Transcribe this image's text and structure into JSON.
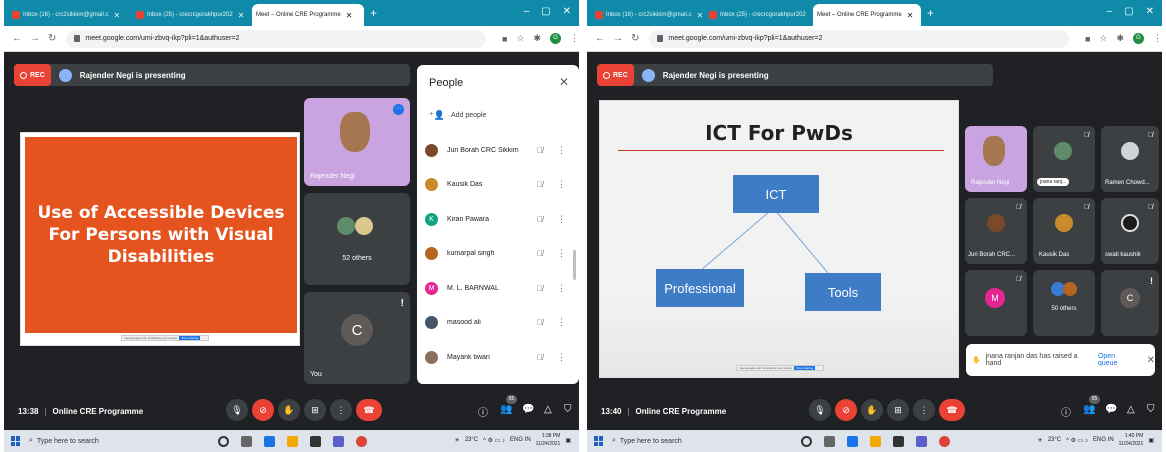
{
  "left": {
    "tabs": [
      {
        "label": "Inbox (16) - crc2sikkim@gmail.c"
      },
      {
        "label": "Inbox (25) - crecrcgorakhpur202"
      },
      {
        "label": "Meet – Online CRE Programme"
      }
    ],
    "url": "meet.google.com/umi-zbvq-ikp?pli=1&authuser=2",
    "rec_label": "REC",
    "presenting": "Rajender Negi is presenting",
    "slide_text": "Use of Accessible Devices For Persons with Visual Disabilities",
    "tile_presenter": "Rajender Negi",
    "tile_others": "52 others",
    "tile_you_name": "You",
    "tile_you_initial": "C",
    "people": {
      "title": "People",
      "add_people": "Add people",
      "list": [
        {
          "name": "Juri Borah CRC Sikkim",
          "color": "#7b4a2b"
        },
        {
          "name": "Kausik Das",
          "color": "#c88a2c"
        },
        {
          "name": "Kiran Pawara",
          "initial": "K",
          "color": "#12a37f"
        },
        {
          "name": "kumarpal singh",
          "color": "#b5651d"
        },
        {
          "name": "M. L. BARNWAL",
          "initial": "M",
          "color": "#e52592"
        },
        {
          "name": "masood ali",
          "color": "#445566"
        },
        {
          "name": "Mayank tiwari",
          "color": "#8d6e63"
        }
      ]
    },
    "time": "13:38",
    "meeting_title": "Online CRE Programme",
    "participant_count": "55",
    "taskbar": {
      "search": "Type here to search",
      "temp": "23°C",
      "lang": "ENG IN",
      "clock_time": "1:38 PM",
      "clock_date": "11/24/2021"
    }
  },
  "right": {
    "tabs": [
      {
        "label": "Inbox (16) - crc2sikkim@gmail.c"
      },
      {
        "label": "Inbox (25) - crecrcgorakhpur202"
      },
      {
        "label": "Meet – Online CRE Programme"
      }
    ],
    "url": "meet.google.com/umi-zbvq-ikp?pli=1&authuser=2",
    "rec_label": "REC",
    "presenting": "Rajender Negi is presenting",
    "slide": {
      "title": "ICT For PwDs",
      "center": "ICT",
      "left": "Professional",
      "right": "Tools"
    },
    "tiles": [
      {
        "name": "Rajender Negi"
      },
      {
        "name": "jnana ranj..."
      },
      {
        "name": "Ramen Chowd..."
      },
      {
        "name": "Juri Borah CRC..."
      },
      {
        "name": "Kausik Das"
      },
      {
        "name": "swati kaushik"
      },
      {
        "name": "M"
      },
      {
        "name": "50 others"
      },
      {
        "name": "C"
      }
    ],
    "raise_hand": "jnana ranjan das has raised a hand",
    "open_queue": "Open queue",
    "time": "13:40",
    "meeting_title": "Online CRE Programme",
    "participant_count": "55",
    "taskbar": {
      "search": "Type here to search",
      "temp": "23°C",
      "lang": "ENG IN",
      "clock_time": "1:40 PM",
      "clock_date": "11/24/2021"
    }
  },
  "colors": {
    "meet_bg": "#202124",
    "tile_bg": "#3c4043",
    "red": "#ea4335",
    "tabbar": "#0f8aa8",
    "slide_orange": "#e5531f",
    "diagram_blue": "#3e7cc5"
  }
}
